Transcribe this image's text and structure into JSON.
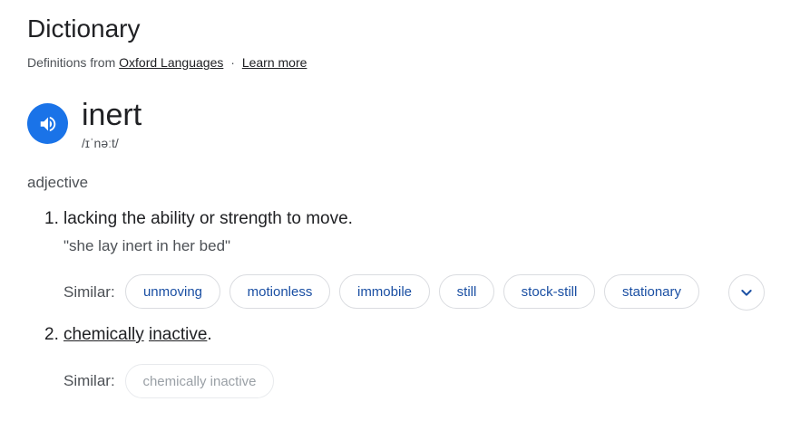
{
  "header": {
    "title": "Dictionary",
    "source_prefix": "Definitions from",
    "source_link": "Oxford Languages",
    "separator": "·",
    "learn_more": "Learn more"
  },
  "entry": {
    "word": "inert",
    "phonetic": "/ɪˈnəːt/",
    "part_of_speech": "adjective"
  },
  "senses": [
    {
      "number": "1.",
      "definition": "lacking the ability or strength to move.",
      "example": "\"she lay inert in her bed\"",
      "similar_label": "Similar:",
      "similar": [
        "unmoving",
        "motionless",
        "immobile",
        "still",
        "stock-still",
        "stationary"
      ]
    },
    {
      "number": "2.",
      "definition_parts": [
        "chemically",
        " ",
        "inactive",
        "."
      ],
      "similar_label": "Similar:",
      "similar": [
        "chemically inactive"
      ]
    }
  ],
  "icons": {
    "speaker": "speaker-icon",
    "expand": "chevron-down-icon"
  },
  "colors": {
    "accent": "#1a73e8",
    "chip_text": "#1a4fa3",
    "muted": "#4d5156"
  }
}
